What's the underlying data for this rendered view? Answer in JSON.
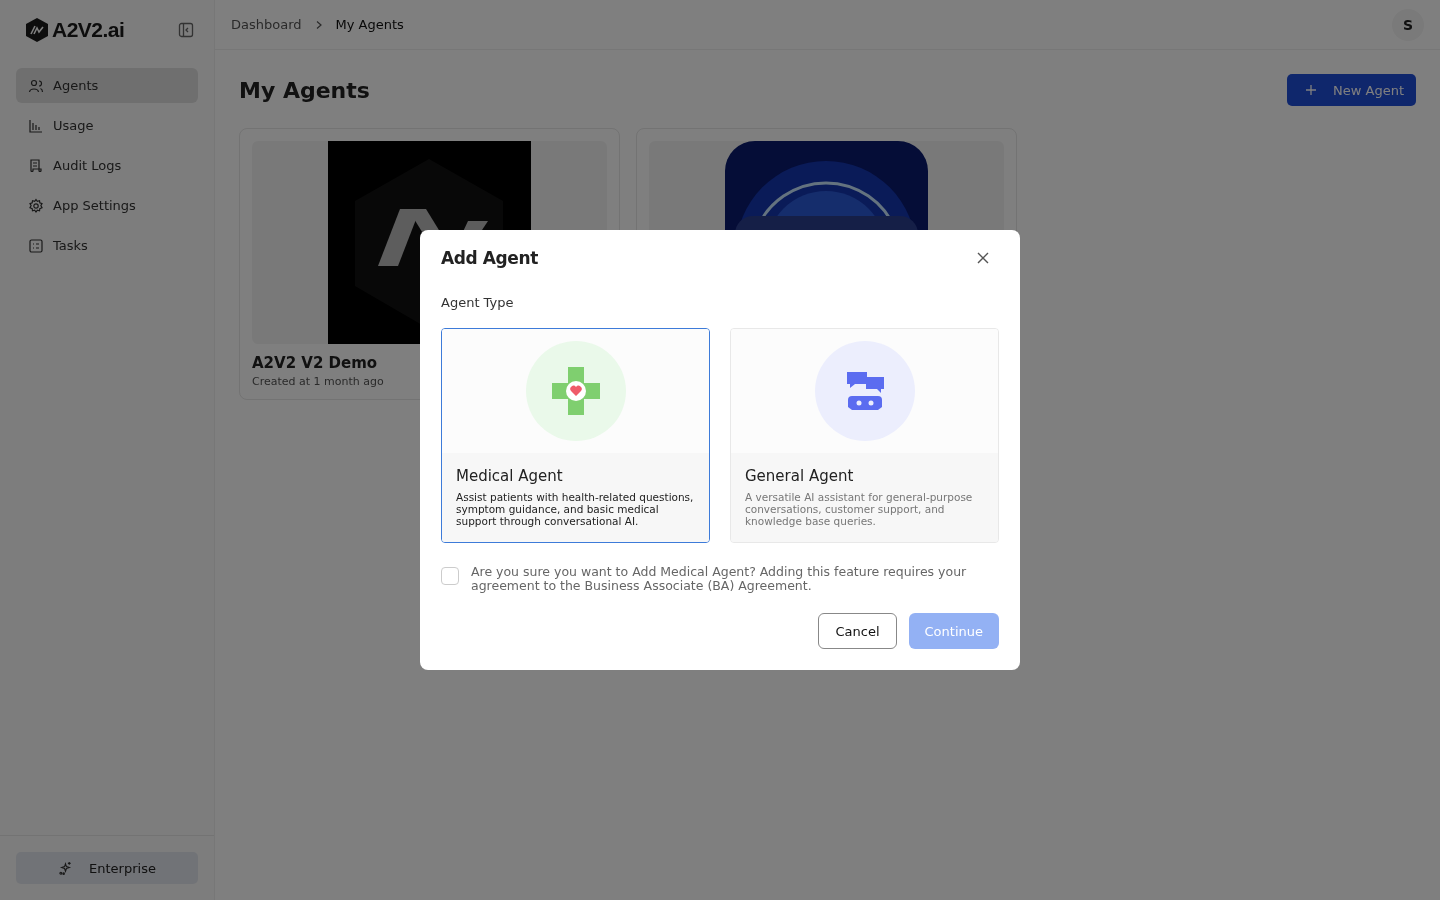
{
  "sidebar": {
    "logo": "A2V2.ai",
    "items": [
      {
        "label": "Agents",
        "selected": true
      },
      {
        "label": "Usage",
        "selected": false
      },
      {
        "label": "Audit Logs",
        "selected": false
      },
      {
        "label": "App Settings",
        "selected": false
      },
      {
        "label": "Tasks",
        "selected": false
      }
    ],
    "footer_button": "Enterprise"
  },
  "breadcrumb": [
    "Dashboard",
    "My Agents"
  ],
  "avatar": "S",
  "page_title": "My Agents",
  "new_agent_button": "New Agent",
  "agents": [
    {
      "name": "A2V2 V2 Demo",
      "created": "Created at 1 month ago",
      "kind": "picture"
    },
    {
      "kind": "picture"
    }
  ],
  "modal": {
    "title": "Add Agent",
    "section_label": "Agent Type",
    "options": [
      {
        "kind": "medical",
        "title": "Medical Agent",
        "description": "Assist patients with health-related questions, symptom guidance, and basic medical support through conversational AI.",
        "selected": true
      },
      {
        "kind": "general",
        "title": "General Agent",
        "description": "A versatile AI assistant for general-purpose conversations, customer support, and knowledge base queries.",
        "selected": false
      }
    ],
    "consent": {
      "text": "Are you sure you want to Add Medical Agent? Adding this feature requires your agreement to the Business Associate (BA) Agreement.",
      "checked": false
    },
    "cancel_button": "Cancel",
    "continue_button": {
      "label": "Continue",
      "disabled": true
    }
  }
}
